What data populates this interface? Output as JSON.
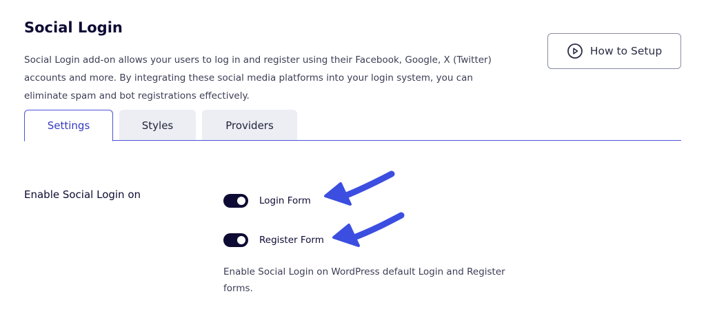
{
  "header": {
    "title": "Social Login",
    "description": "Social Login add-on allows your users to log in and register using their Facebook, Google, X (Twitter) accounts and more. By integrating these social media platforms into your login system, you can eliminate spam and bot registrations effectively."
  },
  "setup_button": {
    "label": "How to Setup",
    "icon": "play-circle-icon"
  },
  "tabs": [
    {
      "label": "Settings",
      "active": true
    },
    {
      "label": "Styles",
      "active": false
    },
    {
      "label": "Providers",
      "active": false
    }
  ],
  "settings": {
    "enable_label": "Enable Social Login on",
    "toggles": [
      {
        "label": "Login Form",
        "checked": true
      },
      {
        "label": "Register Form",
        "checked": true
      }
    ],
    "helper_text": "Enable Social Login on WordPress default Login and Register forms."
  },
  "colors": {
    "accent": "#4b53d8",
    "arrow": "#3c4ee0",
    "toggle_on": "#0d0b33",
    "tab_inactive_bg": "#eceef4"
  }
}
